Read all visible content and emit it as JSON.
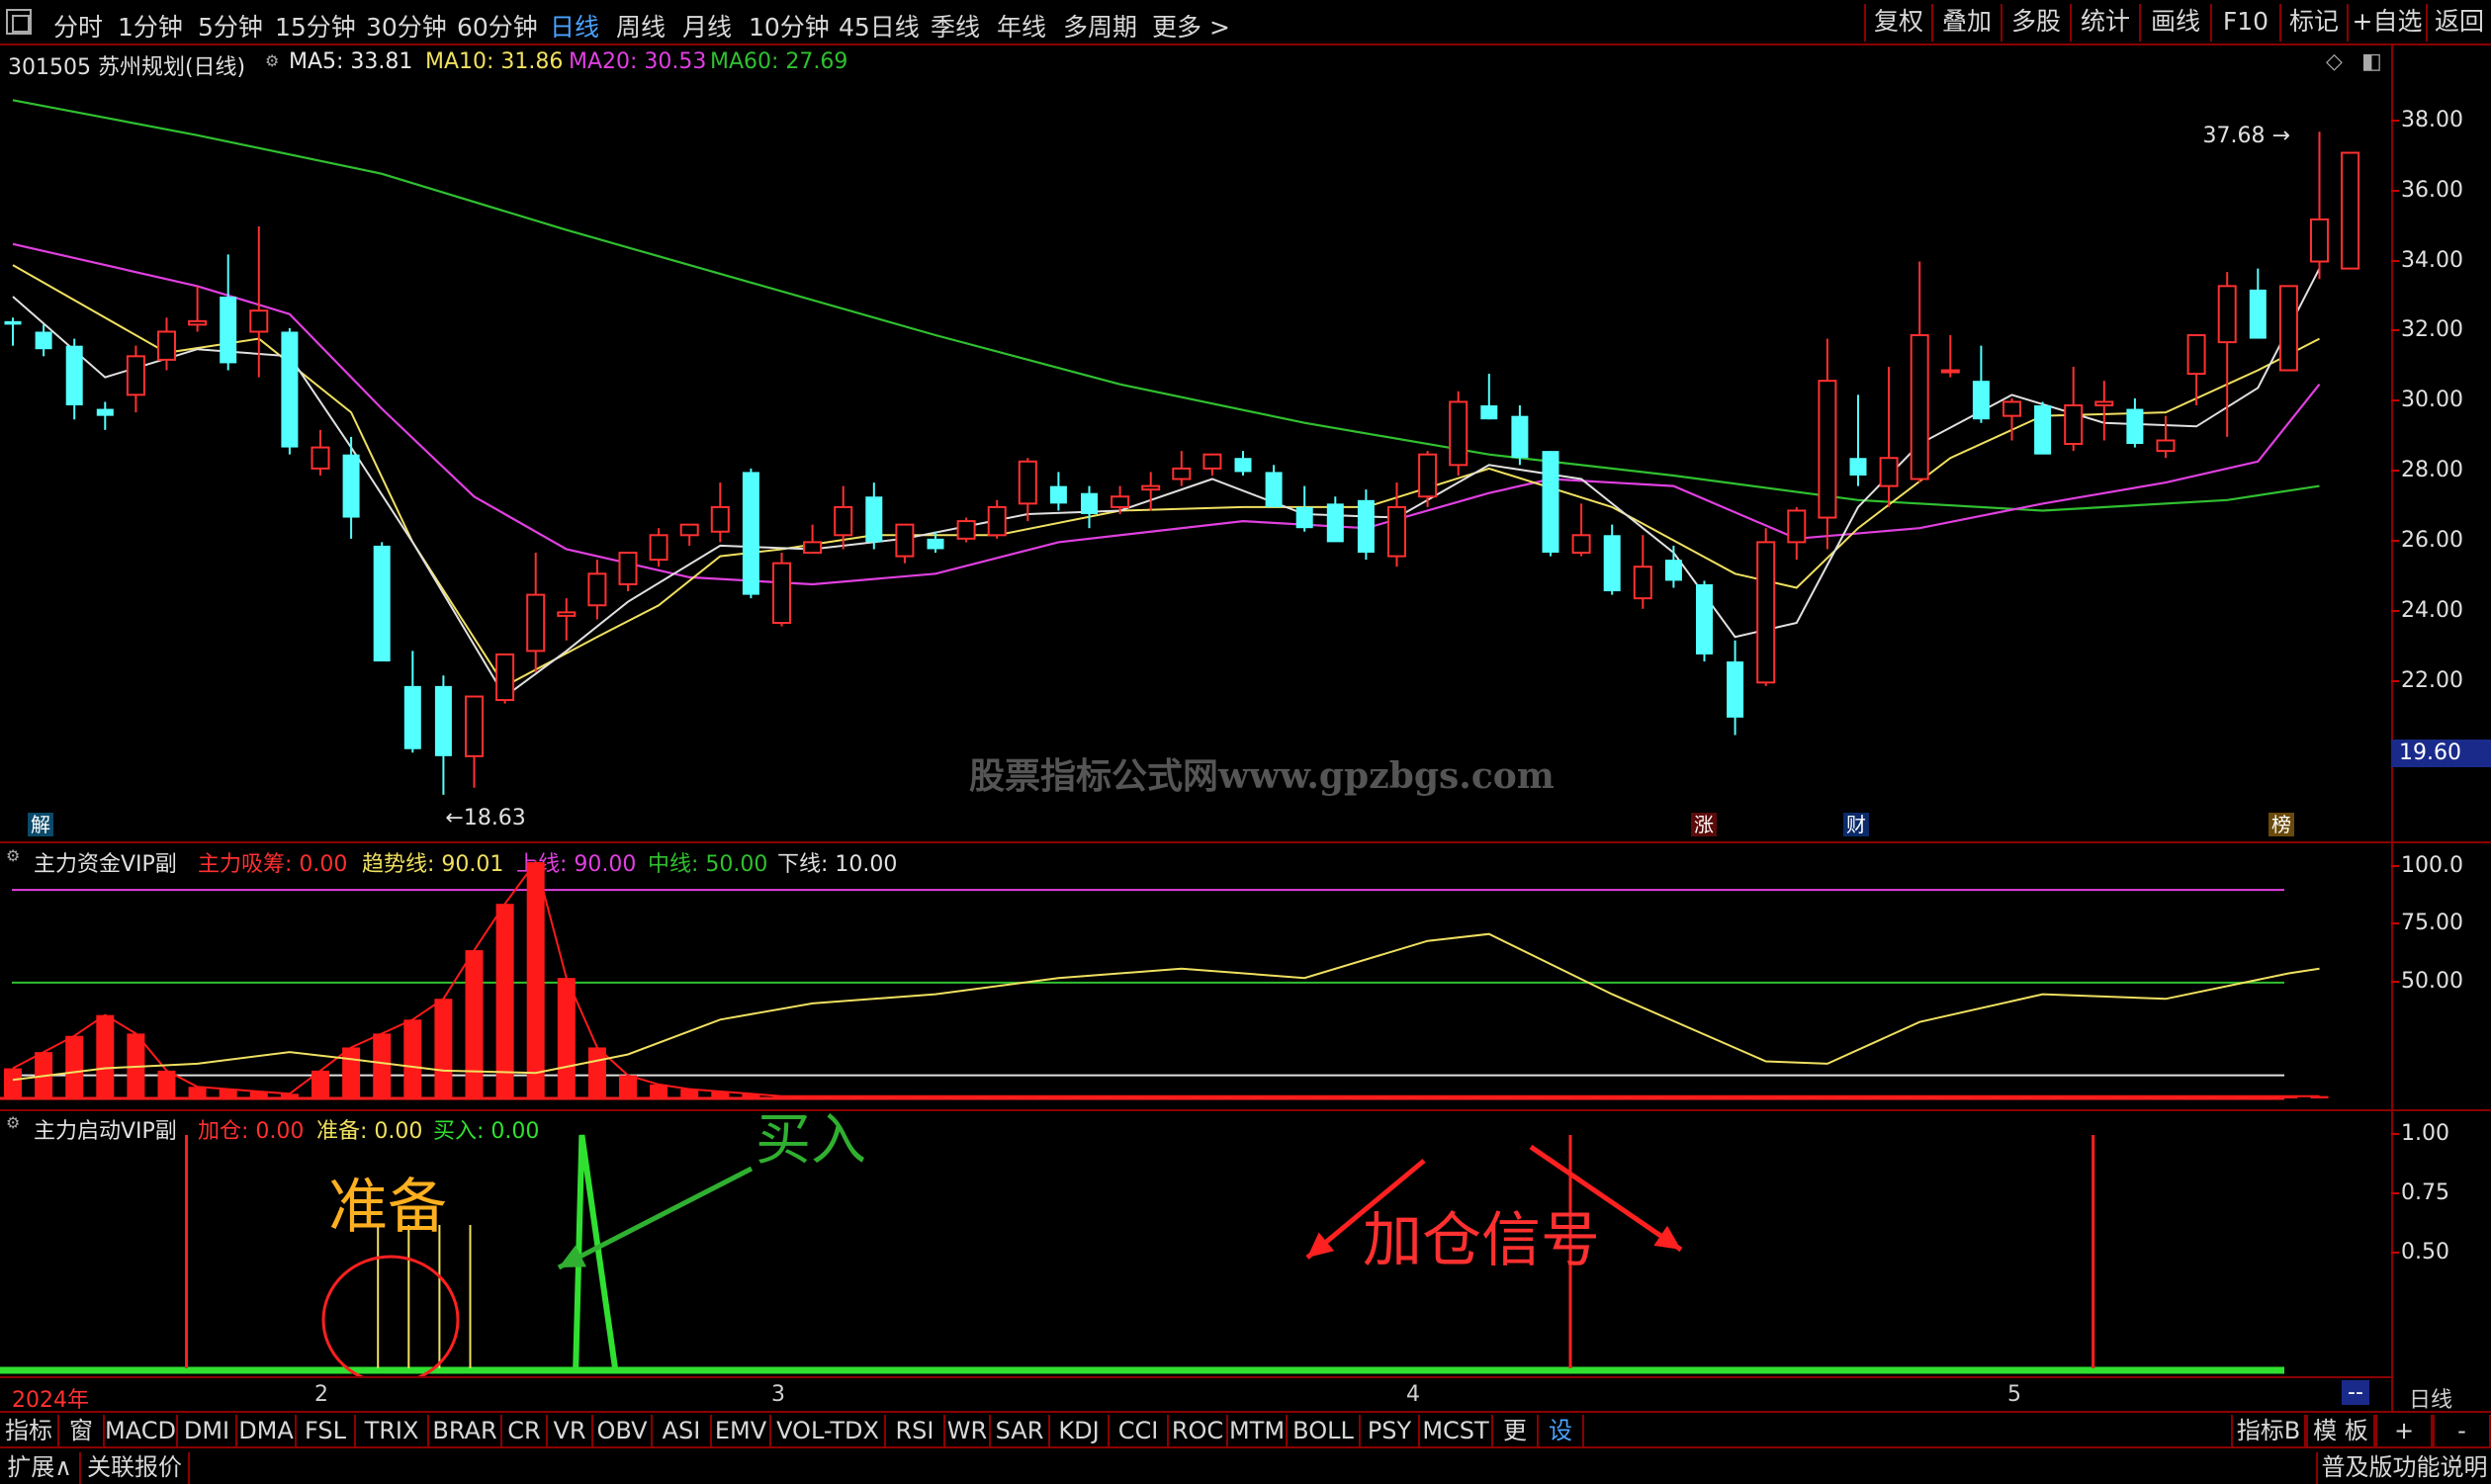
{
  "toolbar": {
    "periods": [
      "分时",
      "1分钟",
      "5分钟",
      "15分钟",
      "30分钟",
      "60分钟",
      "日线",
      "周线",
      "月线",
      "10分钟",
      "45日线",
      "季线",
      "年线",
      "多周期",
      "更多 >"
    ],
    "active_period": "日线",
    "right_buttons": [
      "复权",
      "叠加",
      "多股",
      "统计",
      "画线",
      "F10",
      "标记",
      "+自选",
      "返回"
    ]
  },
  "main_chart": {
    "stock_title": "301505 苏州规划(日线)",
    "ma5": "MA5: 33.81",
    "ma10": "MA10: 31.86",
    "ma20": "MA20: 30.53",
    "ma60": "MA60: 27.69",
    "high_label": "37.68",
    "low_label": "18.63",
    "current_price_tag": "19.60",
    "watermark": "股票指标公式网www.gpzbgs.com",
    "badges": {
      "jie": "解",
      "zhang": "涨",
      "cai": "财",
      "bang": "榜"
    },
    "colors": {
      "up": "#ff3030",
      "down": "#54ffff",
      "ma5": "#e0e0e0",
      "ma10": "#f0e060",
      "ma20": "#e040e0",
      "ma60": "#30c030"
    }
  },
  "sub1": {
    "name": "主力资金VIP副",
    "zhuli": "主力吸筹: 0.00",
    "qushi": "趋势线: 90.01",
    "shangxian": "上线: 90.00",
    "zhongxian": "中线: 50.00",
    "xiaxian": "下线: 10.00"
  },
  "sub2": {
    "name": "主力启动VIP副",
    "jiacang": "加仓: 0.00",
    "zhunbei": "准备: 0.00",
    "mairu": "买入: 0.00",
    "ann_zhunbei": "准备",
    "ann_mairu": "买入",
    "ann_jiacang": "加仓信号"
  },
  "axis": {
    "date_labels": [
      "2024年",
      "2",
      "3",
      "4",
      "5"
    ],
    "right_labels": [
      "--",
      "日线"
    ]
  },
  "indicator_tabs": [
    "指标A",
    "窗口",
    "MACD",
    "DMI",
    "DMA",
    "FSL",
    "TRIX",
    "BRAR",
    "CR",
    "VR",
    "OBV",
    "ASI",
    "EMV",
    "VOL-TDX",
    "RSI",
    "WR",
    "SAR",
    "KDJ",
    "CCI",
    "ROC",
    "MTM",
    "BOLL",
    "PSY",
    "MCST",
    "更多",
    "设置"
  ],
  "indicator_right": [
    "指标B",
    "模 板",
    "+",
    "-"
  ],
  "status_bar": {
    "expand": "扩展∧",
    "related": "关联报价",
    "right": "普及版功能说明"
  },
  "chart_data": [
    {
      "type": "candlestick",
      "title": "301505 苏州规划(日线)",
      "ylim": [
        17.5,
        39.2
      ],
      "y_ticks": [
        "38.00",
        "36.00",
        "34.00",
        "32.00",
        "30.00",
        "28.00",
        "26.00",
        "24.00",
        "22.00"
      ],
      "candles": [
        [
          32.3,
          32.4,
          31.6,
          32.2
        ],
        [
          32.0,
          32.2,
          31.3,
          31.5
        ],
        [
          31.6,
          31.8,
          29.5,
          29.9
        ],
        [
          29.8,
          30.0,
          29.2,
          29.6
        ],
        [
          30.2,
          31.6,
          29.7,
          31.3
        ],
        [
          31.2,
          32.4,
          30.9,
          32.0
        ],
        [
          32.2,
          33.3,
          32.0,
          32.3
        ],
        [
          33.0,
          34.2,
          30.9,
          31.1
        ],
        [
          32.0,
          35.0,
          30.7,
          32.6
        ],
        [
          32.0,
          32.1,
          28.5,
          28.7
        ],
        [
          28.1,
          29.2,
          27.9,
          28.7
        ],
        [
          28.5,
          29.0,
          26.1,
          26.7
        ],
        [
          25.9,
          26.0,
          22.6,
          22.6
        ],
        [
          21.9,
          22.9,
          20.0,
          20.1
        ],
        [
          21.9,
          22.2,
          18.8,
          19.9
        ],
        [
          19.9,
          21.5,
          19.0,
          21.6
        ],
        [
          21.5,
          22.6,
          21.4,
          22.8
        ],
        [
          22.9,
          25.7,
          22.3,
          24.5
        ],
        [
          23.9,
          24.4,
          23.2,
          24.0
        ],
        [
          24.2,
          25.5,
          23.8,
          25.1
        ],
        [
          24.8,
          25.6,
          24.6,
          25.7
        ],
        [
          25.5,
          26.4,
          25.3,
          26.2
        ],
        [
          26.2,
          26.5,
          25.9,
          26.5
        ],
        [
          26.3,
          27.7,
          26.0,
          27.0
        ],
        [
          28.0,
          28.1,
          24.4,
          24.5
        ],
        [
          23.7,
          25.7,
          23.6,
          25.4
        ],
        [
          25.7,
          26.5,
          25.7,
          26.0
        ],
        [
          26.2,
          27.6,
          25.8,
          27.0
        ],
        [
          27.3,
          27.7,
          25.8,
          26.0
        ],
        [
          25.6,
          26.5,
          25.4,
          26.5
        ],
        [
          26.1,
          26.3,
          25.7,
          25.8
        ],
        [
          26.1,
          26.7,
          26.0,
          26.6
        ],
        [
          26.2,
          27.2,
          26.1,
          27.0
        ],
        [
          27.1,
          28.4,
          26.6,
          28.3
        ],
        [
          27.6,
          28.0,
          26.9,
          27.1
        ],
        [
          27.4,
          27.6,
          26.4,
          26.8
        ],
        [
          27.0,
          27.6,
          26.8,
          27.3
        ],
        [
          27.5,
          28.0,
          26.9,
          27.6
        ],
        [
          27.8,
          28.6,
          27.6,
          28.1
        ],
        [
          28.1,
          28.3,
          27.9,
          28.5
        ],
        [
          28.4,
          28.6,
          27.9,
          28.0
        ],
        [
          28.0,
          28.2,
          27.0,
          27.0
        ],
        [
          27.0,
          27.6,
          26.3,
          26.4
        ],
        [
          27.1,
          27.3,
          26.2,
          26.0
        ],
        [
          27.2,
          27.5,
          25.5,
          25.7
        ],
        [
          25.6,
          27.7,
          25.3,
          27.0
        ],
        [
          27.3,
          28.6,
          27.0,
          28.5
        ],
        [
          28.2,
          30.3,
          27.9,
          30.0
        ],
        [
          29.9,
          30.8,
          29.5,
          29.5
        ],
        [
          29.6,
          29.9,
          28.2,
          28.4
        ],
        [
          28.6,
          28.6,
          25.6,
          25.7
        ],
        [
          25.7,
          27.1,
          25.6,
          26.2
        ],
        [
          26.2,
          26.5,
          24.5,
          24.6
        ],
        [
          24.4,
          26.2,
          24.1,
          25.3
        ],
        [
          25.5,
          25.9,
          24.7,
          24.9
        ],
        [
          24.8,
          24.9,
          22.6,
          22.8
        ],
        [
          22.6,
          23.2,
          20.5,
          21.0
        ],
        [
          22.0,
          26.4,
          21.9,
          26.0
        ],
        [
          26.0,
          27.0,
          25.5,
          26.9
        ],
        [
          26.7,
          31.8,
          25.8,
          30.6
        ],
        [
          28.4,
          30.2,
          27.6,
          27.9
        ],
        [
          27.6,
          31.0,
          27.0,
          28.4
        ],
        [
          27.8,
          34.0,
          27.7,
          31.9
        ],
        [
          30.9,
          31.9,
          30.7,
          30.9
        ],
        [
          30.6,
          31.6,
          29.4,
          29.5
        ],
        [
          29.6,
          30.1,
          28.9,
          30.0
        ],
        [
          29.9,
          30.0,
          28.7,
          28.5
        ],
        [
          28.8,
          31.0,
          28.6,
          29.9
        ],
        [
          29.9,
          30.6,
          28.9,
          30.0
        ],
        [
          29.8,
          30.1,
          28.7,
          28.8
        ],
        [
          28.6,
          29.6,
          28.4,
          28.9
        ],
        [
          30.8,
          31.7,
          29.9,
          31.9
        ],
        [
          31.7,
          33.7,
          29.0,
          33.3
        ],
        [
          33.2,
          33.8,
          31.9,
          31.8
        ],
        [
          30.9,
          33.3,
          30.9,
          33.3
        ],
        [
          34.0,
          37.7,
          33.5,
          35.2
        ],
        [
          33.8,
          37.1,
          33.8,
          37.1
        ]
      ],
      "ma60": [
        [
          0,
          38.6
        ],
        [
          6,
          37.6
        ],
        [
          12,
          36.5
        ],
        [
          18,
          34.9
        ],
        [
          24,
          33.4
        ],
        [
          30,
          31.9
        ],
        [
          36,
          30.5
        ],
        [
          42,
          29.4
        ],
        [
          48,
          28.5
        ],
        [
          54,
          27.9
        ],
        [
          60,
          27.2
        ],
        [
          66,
          26.9
        ],
        [
          72,
          27.2
        ],
        [
          75,
          27.6
        ]
      ],
      "ma20": [
        [
          0,
          34.5
        ],
        [
          6,
          33.3
        ],
        [
          9,
          32.5
        ],
        [
          12,
          29.8
        ],
        [
          15,
          27.3
        ],
        [
          18,
          25.8
        ],
        [
          22,
          25.0
        ],
        [
          26,
          24.8
        ],
        [
          30,
          25.1
        ],
        [
          34,
          26.0
        ],
        [
          40,
          26.6
        ],
        [
          44,
          26.4
        ],
        [
          48,
          27.4
        ],
        [
          50,
          27.8
        ],
        [
          54,
          27.6
        ],
        [
          58,
          26.1
        ],
        [
          62,
          26.4
        ],
        [
          66,
          27.1
        ],
        [
          70,
          27.7
        ],
        [
          73,
          28.3
        ],
        [
          75,
          30.5
        ]
      ],
      "ma10": [
        [
          0,
          33.9
        ],
        [
          5,
          31.4
        ],
        [
          8,
          31.8
        ],
        [
          11,
          29.7
        ],
        [
          13,
          26.0
        ],
        [
          16,
          21.9
        ],
        [
          19,
          23.3
        ],
        [
          21,
          24.2
        ],
        [
          23,
          25.6
        ],
        [
          25,
          25.8
        ],
        [
          28,
          26.2
        ],
        [
          32,
          26.2
        ],
        [
          36,
          26.9
        ],
        [
          40,
          27.0
        ],
        [
          44,
          27.0
        ],
        [
          48,
          28.1
        ],
        [
          52,
          27.0
        ],
        [
          56,
          25.1
        ],
        [
          58,
          24.7
        ],
        [
          60,
          26.4
        ],
        [
          63,
          28.4
        ],
        [
          66,
          29.6
        ],
        [
          70,
          29.7
        ],
        [
          73,
          30.9
        ],
        [
          75,
          31.8
        ]
      ],
      "ma5": [
        [
          0,
          33.0
        ],
        [
          3,
          30.7
        ],
        [
          6,
          31.5
        ],
        [
          9,
          31.3
        ],
        [
          11,
          28.7
        ],
        [
          13,
          26.0
        ],
        [
          16,
          21.6
        ],
        [
          18,
          22.9
        ],
        [
          20,
          24.3
        ],
        [
          23,
          25.9
        ],
        [
          26,
          25.8
        ],
        [
          29,
          26.1
        ],
        [
          33,
          26.8
        ],
        [
          36,
          26.9
        ],
        [
          39,
          27.8
        ],
        [
          42,
          26.8
        ],
        [
          45,
          26.7
        ],
        [
          48,
          28.2
        ],
        [
          51,
          27.8
        ],
        [
          54,
          25.7
        ],
        [
          56,
          23.3
        ],
        [
          58,
          23.7
        ],
        [
          60,
          27.0
        ],
        [
          62,
          28.8
        ],
        [
          65,
          30.2
        ],
        [
          68,
          29.4
        ],
        [
          71,
          29.3
        ],
        [
          73,
          30.4
        ],
        [
          75,
          33.8
        ]
      ]
    },
    {
      "type": "bar",
      "title": "主力资金VIP副",
      "ylim": [
        0,
        105
      ],
      "y_ticks": [
        "100.0",
        "75.00",
        "50.00"
      ],
      "reference_lines": {
        "upper": 90,
        "middle": 50,
        "lower": 10
      },
      "bars": [
        [
          0,
          13
        ],
        [
          1,
          20
        ],
        [
          2,
          27
        ],
        [
          3,
          36
        ],
        [
          4,
          28
        ],
        [
          5,
          12
        ],
        [
          6,
          5
        ],
        [
          7,
          4
        ],
        [
          8,
          3
        ],
        [
          9,
          2
        ],
        [
          10,
          12
        ],
        [
          11,
          22
        ],
        [
          12,
          28
        ],
        [
          13,
          34
        ],
        [
          14,
          43
        ],
        [
          15,
          64
        ],
        [
          16,
          84
        ],
        [
          17,
          102
        ],
        [
          18,
          52
        ],
        [
          19,
          22
        ],
        [
          20,
          10
        ],
        [
          21,
          6
        ],
        [
          22,
          4
        ],
        [
          23,
          3
        ],
        [
          24,
          2
        ],
        [
          25,
          1
        ],
        [
          26,
          1
        ],
        [
          27,
          1
        ],
        [
          28,
          1
        ],
        [
          29,
          1
        ],
        [
          30,
          1
        ],
        [
          31,
          1
        ],
        [
          32,
          1
        ],
        [
          33,
          1
        ],
        [
          34,
          1
        ],
        [
          35,
          1
        ],
        [
          36,
          1
        ],
        [
          37,
          1
        ],
        [
          38,
          1
        ],
        [
          39,
          1
        ],
        [
          40,
          1
        ],
        [
          41,
          1
        ],
        [
          42,
          1
        ],
        [
          43,
          1
        ],
        [
          44,
          1
        ],
        [
          45,
          1
        ],
        [
          46,
          1
        ],
        [
          47,
          1
        ],
        [
          48,
          1
        ],
        [
          49,
          1
        ],
        [
          50,
          1
        ],
        [
          51,
          1
        ],
        [
          52,
          1
        ],
        [
          53,
          1
        ],
        [
          54,
          1
        ],
        [
          55,
          1
        ],
        [
          56,
          1
        ],
        [
          57,
          1
        ],
        [
          58,
          1
        ],
        [
          59,
          1
        ],
        [
          60,
          1
        ],
        [
          61,
          1
        ],
        [
          62,
          1
        ],
        [
          63,
          1
        ],
        [
          64,
          1
        ],
        [
          65,
          1
        ],
        [
          66,
          1
        ],
        [
          67,
          1
        ],
        [
          68,
          1
        ],
        [
          69,
          1
        ],
        [
          70,
          1
        ],
        [
          71,
          1
        ],
        [
          72,
          1
        ],
        [
          73,
          1
        ],
        [
          74,
          1
        ],
        [
          75,
          1
        ]
      ],
      "trend_line": [
        [
          0,
          8
        ],
        [
          3,
          13
        ],
        [
          6,
          15
        ],
        [
          9,
          20
        ],
        [
          11,
          17
        ],
        [
          14,
          12
        ],
        [
          17,
          11
        ],
        [
          20,
          19
        ],
        [
          23,
          34
        ],
        [
          26,
          41
        ],
        [
          30,
          45
        ],
        [
          34,
          52
        ],
        [
          38,
          56
        ],
        [
          42,
          52
        ],
        [
          46,
          68
        ],
        [
          48,
          71
        ],
        [
          52,
          45
        ],
        [
          57,
          16
        ],
        [
          59,
          15
        ],
        [
          62,
          33
        ],
        [
          66,
          45
        ],
        [
          70,
          43
        ],
        [
          74,
          54
        ],
        [
          75,
          56
        ]
      ]
    },
    {
      "type": "line",
      "title": "主力启动VIP副",
      "ylim": [
        0,
        1.1
      ],
      "y_ticks": [
        "1.00",
        "0.75",
        "0.50"
      ],
      "spike_x": [
        18,
        19,
        20
      ],
      "signal_x": [
        5,
        50,
        67
      ]
    }
  ]
}
